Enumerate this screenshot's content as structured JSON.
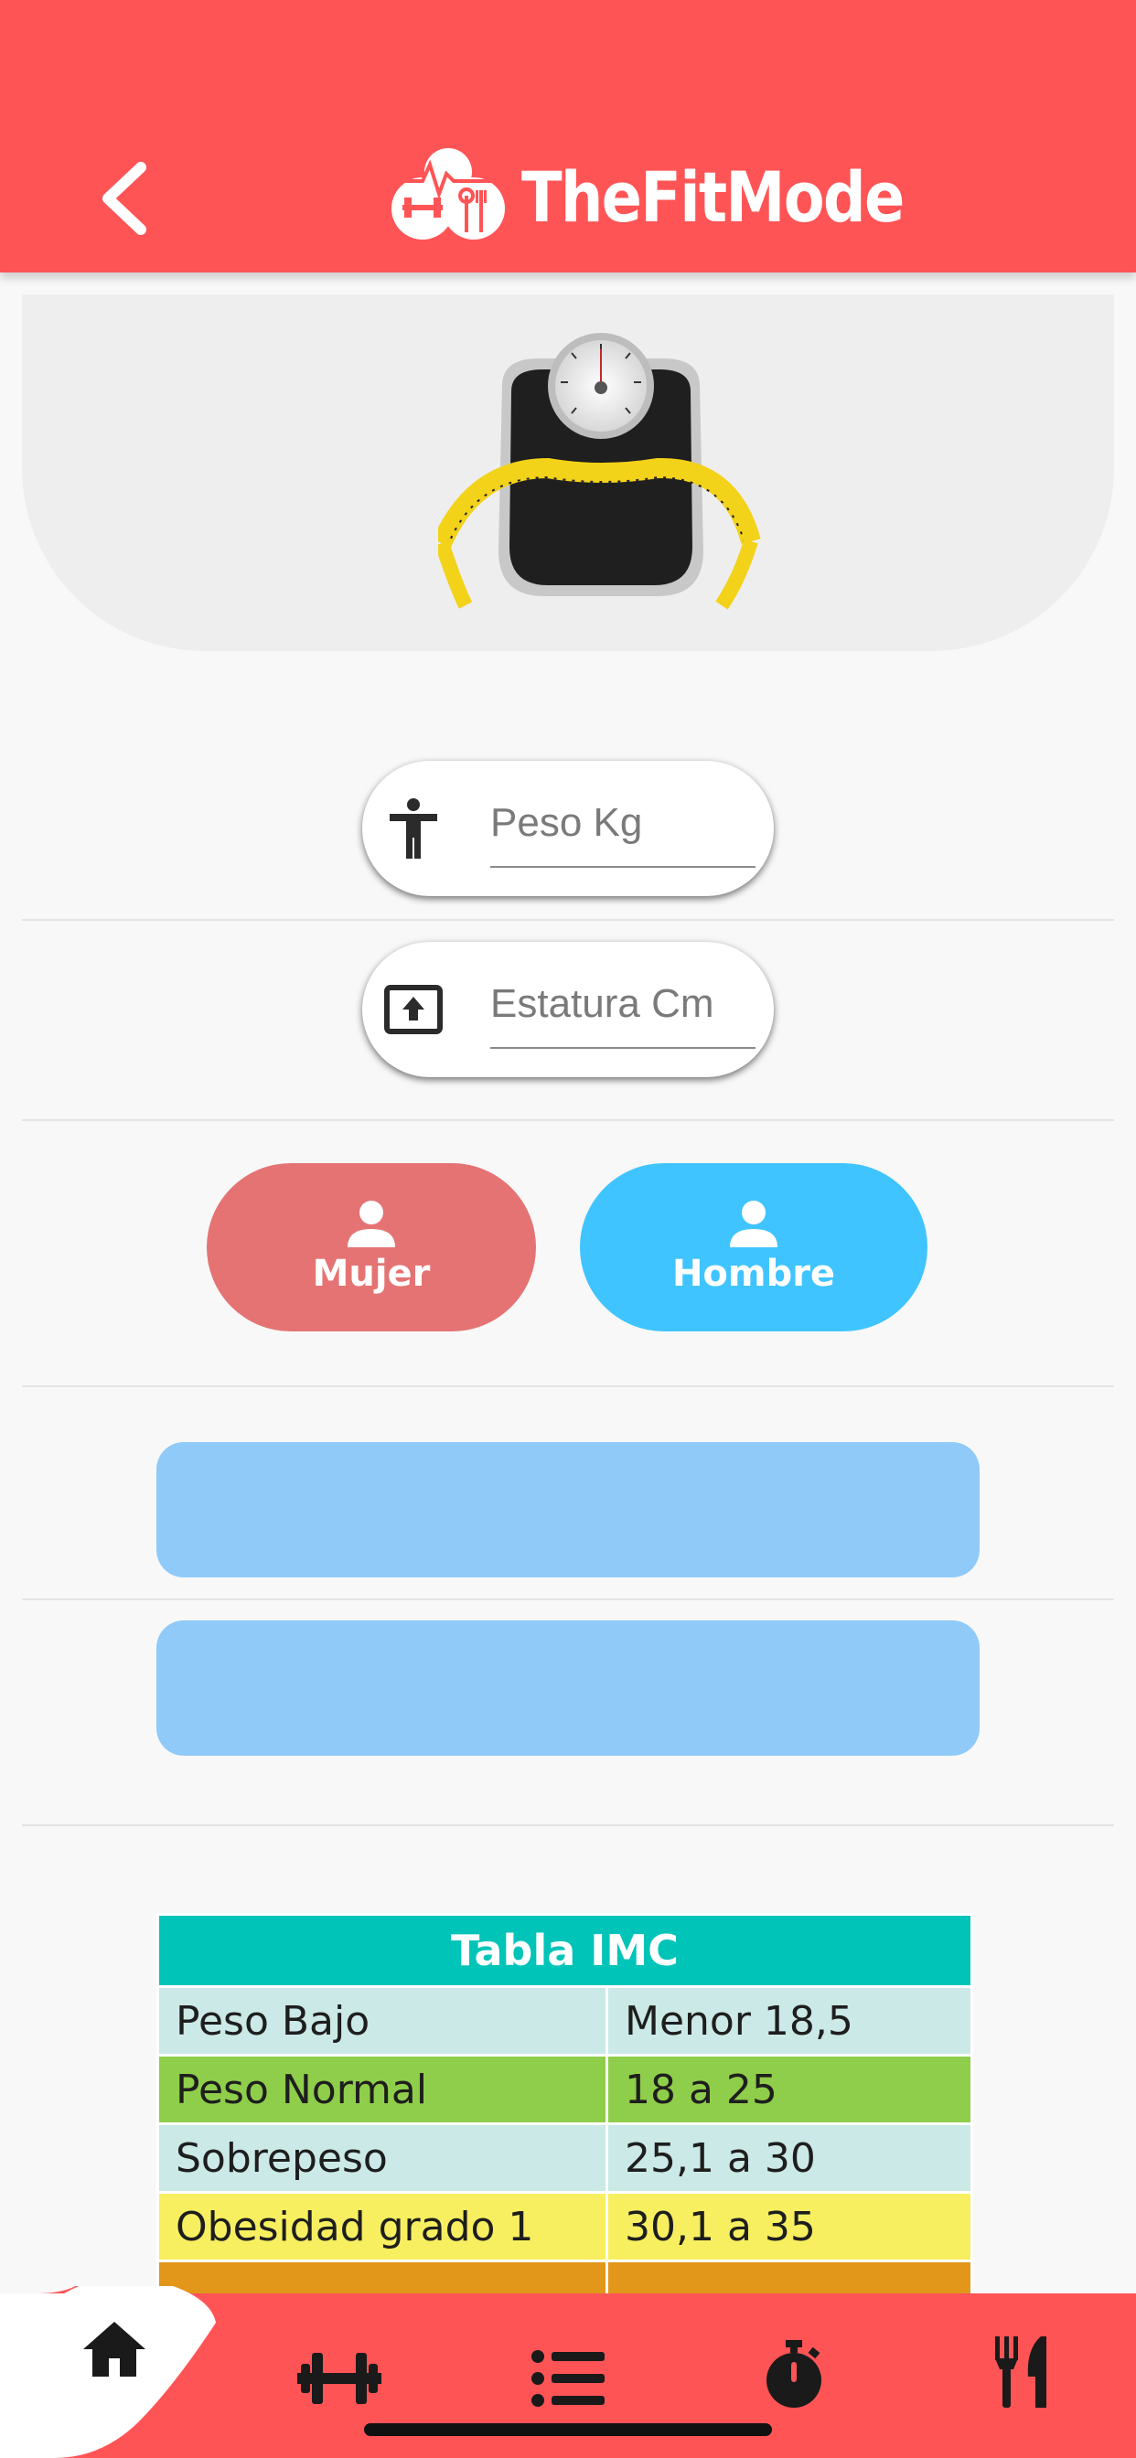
{
  "header": {
    "title": "TheFitMode",
    "back_icon": "chevron-left-icon",
    "logo_icon": "fitness-logo-icon",
    "background_color": "#ff5456"
  },
  "hero": {
    "image": "scale-with-measuring-tape"
  },
  "form": {
    "weight": {
      "placeholder": "Peso Kg",
      "value": "",
      "icon": "person-standing-icon"
    },
    "height": {
      "placeholder": "Estatura Cm",
      "value": "",
      "icon": "height-icon"
    }
  },
  "gender": {
    "female_label": "Mujer",
    "male_label": "Hombre",
    "female_color": "#e57373",
    "male_color": "#40c4ff",
    "icon": "person-icon"
  },
  "results": {
    "first_text": "",
    "second_text": "",
    "bar_color": "#90caf9"
  },
  "imc_table": {
    "title": "Tabla IMC",
    "rows": [
      {
        "category": "Peso Bajo",
        "range": "Menor 18,5",
        "color": "#cbe9e6"
      },
      {
        "category": "Peso Normal",
        "range": "18 a 25",
        "color": "#8fce4a"
      },
      {
        "category": "Sobrepeso",
        "range": "25,1 a 30",
        "color": "#cbe9e6"
      },
      {
        "category": "Obesidad grado 1",
        "range": "30,1 a 35",
        "color": "#f7ef60"
      },
      {
        "category": "",
        "range": "",
        "color": "#e2961a"
      }
    ]
  },
  "nav": {
    "active": "home",
    "items": [
      {
        "name": "home",
        "icon": "home-icon"
      },
      {
        "name": "workouts",
        "icon": "dumbbell-icon"
      },
      {
        "name": "list",
        "icon": "list-icon"
      },
      {
        "name": "timer",
        "icon": "stopwatch-icon"
      },
      {
        "name": "nutrition",
        "icon": "fork-knife-icon"
      }
    ],
    "background_color": "#ff5456"
  }
}
